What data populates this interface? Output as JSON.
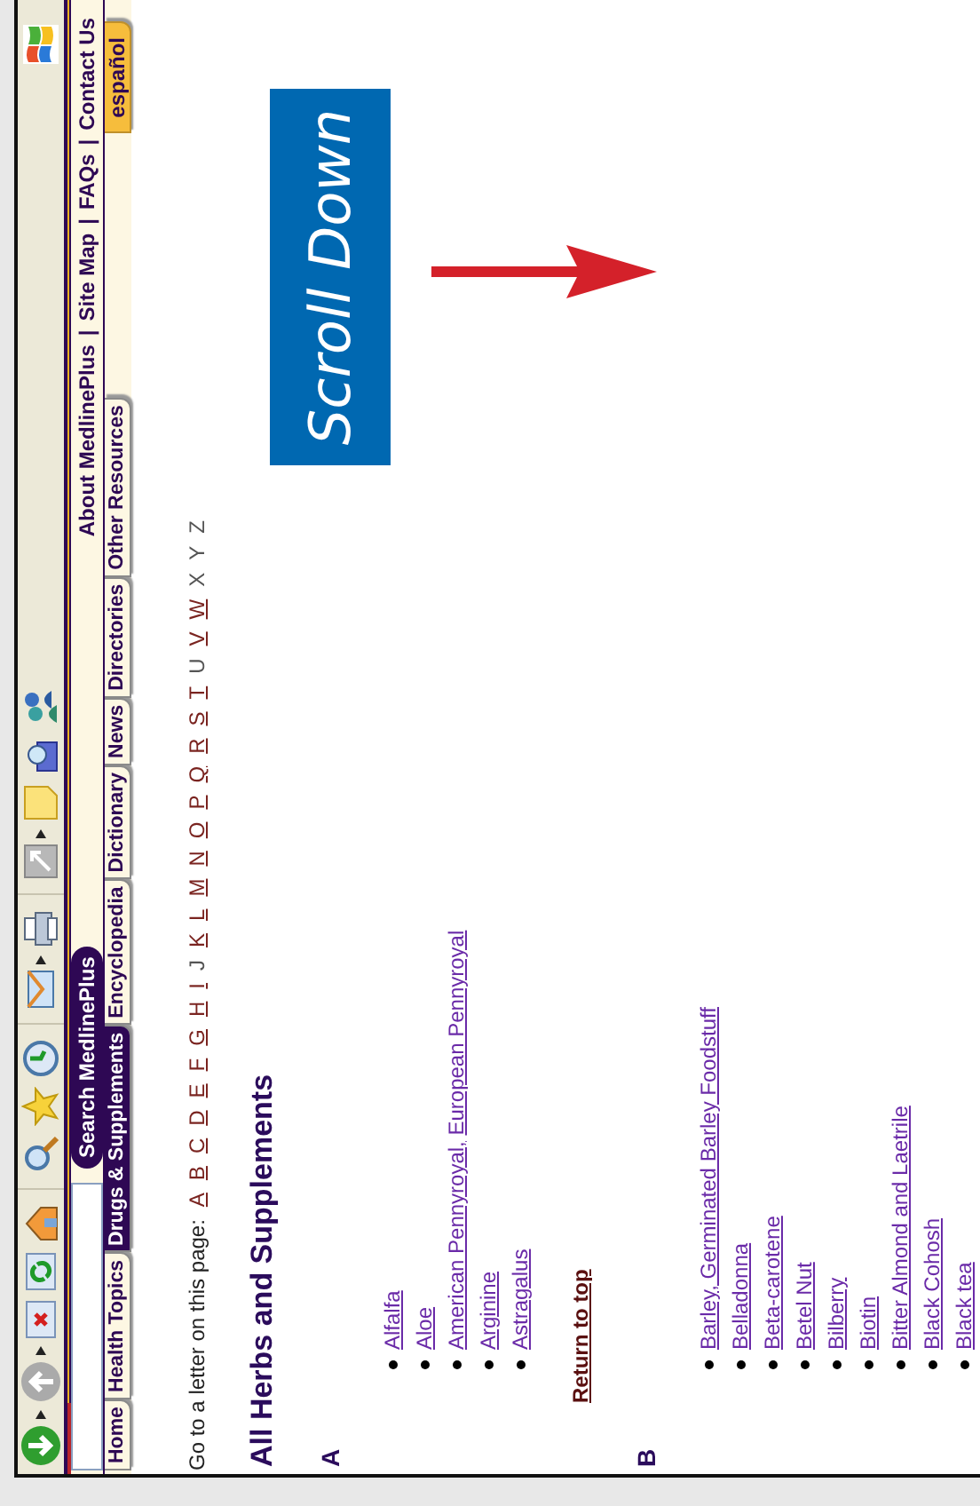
{
  "header": {
    "search_button": "Search MedlinePlus",
    "links": [
      "About MedlinePlus",
      "Site Map",
      "FAQs",
      "Contact Us"
    ],
    "separator": "|",
    "tabs": [
      {
        "label": "Home",
        "selected": false
      },
      {
        "label": "Health Topics",
        "selected": false
      },
      {
        "label": "Drugs & Supplements",
        "selected": true
      },
      {
        "label": "Encyclopedia",
        "selected": false
      },
      {
        "label": "Dictionary",
        "selected": false
      },
      {
        "label": "News",
        "selected": false
      },
      {
        "label": "Directories",
        "selected": false
      },
      {
        "label": "Other Resources",
        "selected": false
      }
    ],
    "language_tab": "español"
  },
  "letter_nav": {
    "label": "Go to a letter on this page:",
    "letters": [
      {
        "letter": "A",
        "linked": true
      },
      {
        "letter": "B",
        "linked": true
      },
      {
        "letter": "C",
        "linked": true
      },
      {
        "letter": "D",
        "linked": true
      },
      {
        "letter": "E",
        "linked": true
      },
      {
        "letter": "F",
        "linked": true
      },
      {
        "letter": "G",
        "linked": true
      },
      {
        "letter": "H",
        "linked": true
      },
      {
        "letter": "I",
        "linked": true
      },
      {
        "letter": "J",
        "linked": false
      },
      {
        "letter": "K",
        "linked": true
      },
      {
        "letter": "L",
        "linked": true
      },
      {
        "letter": "M",
        "linked": true
      },
      {
        "letter": "N",
        "linked": true
      },
      {
        "letter": "O",
        "linked": true
      },
      {
        "letter": "P",
        "linked": true
      },
      {
        "letter": "Q",
        "linked": true
      },
      {
        "letter": "R",
        "linked": true
      },
      {
        "letter": "S",
        "linked": true
      },
      {
        "letter": "T",
        "linked": true
      },
      {
        "letter": "U",
        "linked": false
      },
      {
        "letter": "V",
        "linked": true
      },
      {
        "letter": "W",
        "linked": true
      },
      {
        "letter": "X",
        "linked": false
      },
      {
        "letter": "Y",
        "linked": false
      },
      {
        "letter": "Z",
        "linked": false
      }
    ]
  },
  "title": "All Herbs and Supplements",
  "sections": [
    {
      "letter": "A",
      "items": [
        {
          "links": [
            "Alfalfa"
          ]
        },
        {
          "links": [
            "Aloe"
          ]
        },
        {
          "links": [
            "American Pennyroyal,",
            "European Pennyroyal"
          ]
        },
        {
          "links": [
            "Arginine"
          ]
        },
        {
          "links": [
            "Astragalus"
          ]
        }
      ],
      "return_link": "Return to top"
    },
    {
      "letter": "B",
      "items": [
        {
          "links": [
            "Barley, Germinated Barley Foodstuff"
          ]
        },
        {
          "links": [
            "Belladonna"
          ]
        },
        {
          "links": [
            "Beta-carotene"
          ]
        },
        {
          "links": [
            "Betel Nut"
          ]
        },
        {
          "links": [
            "Bilberry"
          ]
        },
        {
          "links": [
            "Biotin"
          ]
        },
        {
          "links": [
            "Bitter Almond and Laetrile"
          ]
        },
        {
          "links": [
            "Black Cohosh"
          ]
        },
        {
          "links": [
            "Black tea"
          ]
        }
      ]
    }
  ],
  "overlay": {
    "label": "Scroll Down"
  }
}
